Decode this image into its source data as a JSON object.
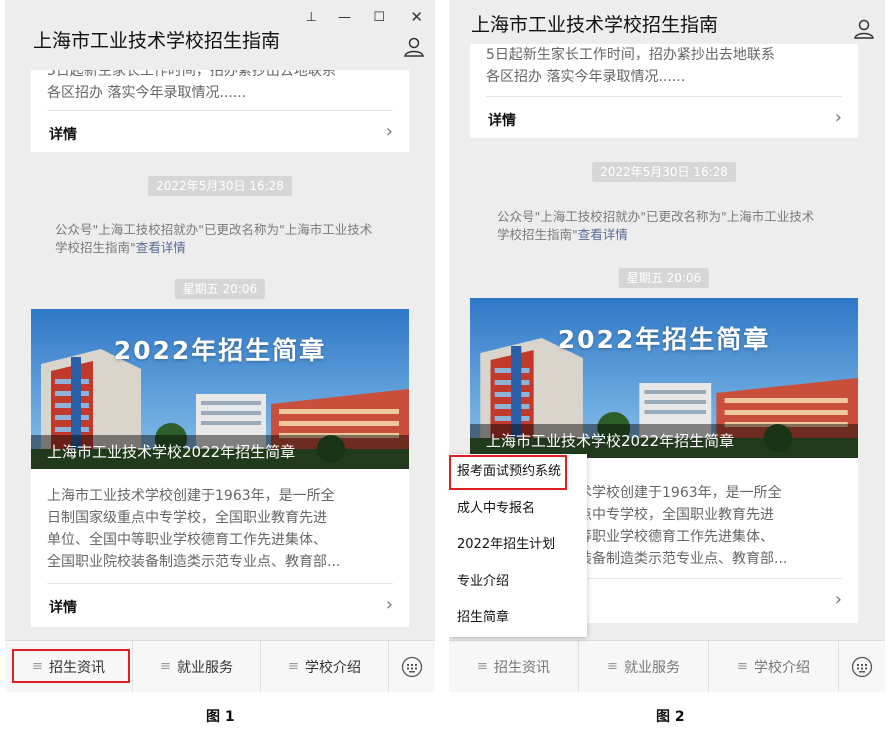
{
  "app_title": "上海市工业技术学校招生指南",
  "window_controls": {
    "pin": "⊥",
    "minimize": "—",
    "maximize": "☐",
    "close": "✕"
  },
  "top_card": {
    "text_line1": "5日起新生家长工作时间，招办紧抄出去地联系",
    "text_line2": "各区招办 落实今年录取情况......",
    "detail_label": "详情",
    "chevron": "›"
  },
  "timestamp1": "2022年5月30日  16:28",
  "notice": {
    "line1": "公众号\"上海工技校招就办\"已更改名称为\"上海市工业技术",
    "line2_prefix": "学校招生指南\"",
    "link": "查看详情"
  },
  "timestamp2": "星期五  20:06",
  "article": {
    "banner_title": "2022年招生简章",
    "banner_caption": "上海市工业技术学校2022年招生简章",
    "summary": [
      "上海市工业技术学校创建于1963年，是一所全",
      "日制国家级重点中专学校，全国职业教育先进",
      "单位、全国中等职业学校德育工作先进集体、",
      "全国职业院校装备制造类示范专业点、教育部..."
    ],
    "summary_partial": [
      "术学校创建于1963年，是一所全",
      "点中专学校，全国职业教育先进",
      "等职业学校德育工作先进集体、",
      "装备制造类示范专业点、教育部..."
    ],
    "detail_label": "详情",
    "chevron": "›"
  },
  "bottom_tabs": [
    {
      "label": "招生资讯"
    },
    {
      "label": "就业服务"
    },
    {
      "label": "学校介绍"
    }
  ],
  "menu_glyph": "≡",
  "popup_menu": [
    {
      "label": "报考面试预约系统"
    },
    {
      "label": "成人中专报名"
    },
    {
      "label": "2022年招生计划"
    },
    {
      "label": "专业介绍"
    },
    {
      "label": "招生简章"
    }
  ],
  "captions": {
    "fig1": "图 1",
    "fig2": "图 2"
  },
  "colors": {
    "highlight": "#e02020",
    "link": "#576b95"
  }
}
